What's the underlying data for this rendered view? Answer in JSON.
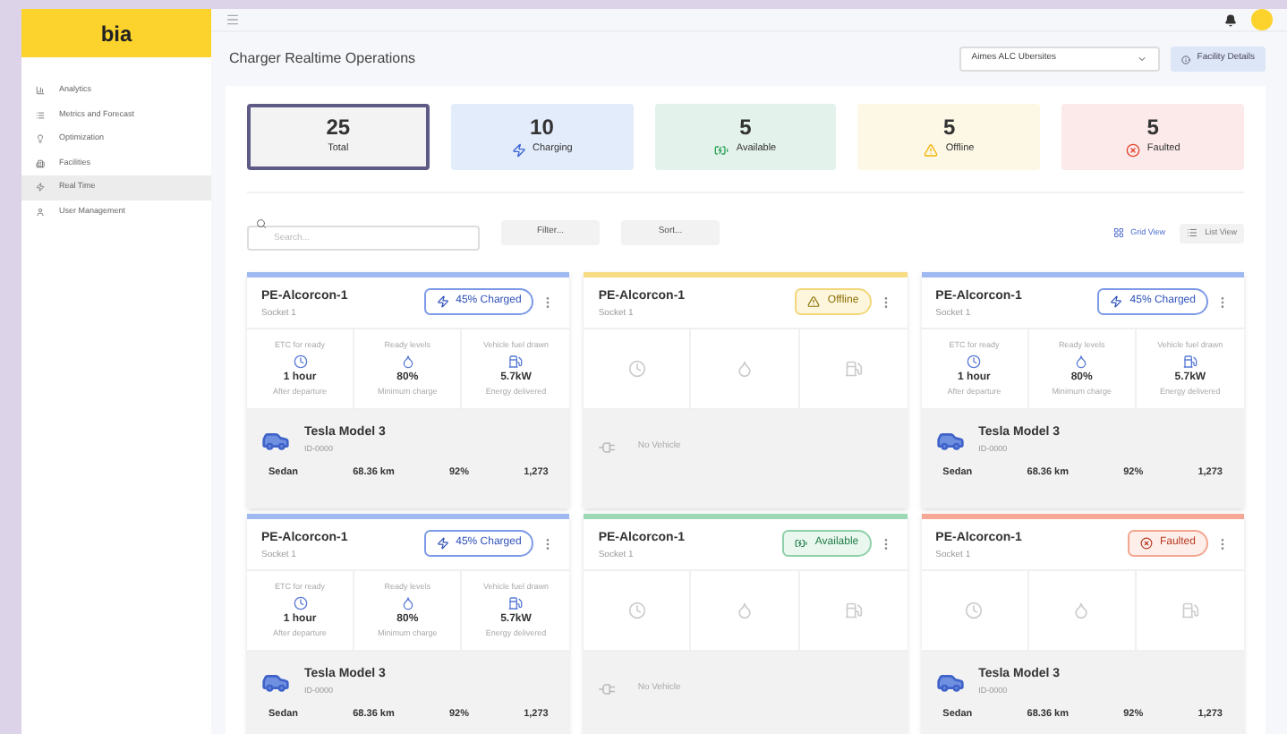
{
  "logo": "bia",
  "sidebar": {
    "items": [
      {
        "label": "Analytics",
        "selected": false
      },
      {
        "label": "Metrics and Forecast",
        "selected": false
      },
      {
        "label": "Optimization",
        "selected": false
      },
      {
        "label": "Facilities",
        "selected": false
      },
      {
        "label": "Real Time",
        "selected": true
      },
      {
        "label": "User Management",
        "selected": false
      }
    ]
  },
  "page_title": "Charger Realtime Operations",
  "facility_select": {
    "value": "Aimes ALC Ubersites"
  },
  "facility_button": "Facility Details",
  "stats": [
    {
      "kind": "total",
      "value": "25",
      "label": "Total",
      "selected": true
    },
    {
      "kind": "charging",
      "value": "10",
      "label": "Charging",
      "selected": false
    },
    {
      "kind": "available",
      "value": "5",
      "label": "Available",
      "selected": false
    },
    {
      "kind": "offline",
      "value": "5",
      "label": "Offline",
      "selected": false
    },
    {
      "kind": "faulted",
      "value": "5",
      "label": "Faulted",
      "selected": false
    }
  ],
  "search": {
    "placeholder": "Search..."
  },
  "filter_button": "Filter...",
  "sort_button": "Sort...",
  "views": [
    {
      "label": "Grid View",
      "selected": true
    },
    {
      "label": "List View",
      "selected": false
    }
  ],
  "chargers": [
    {
      "name": "PE-Alcorcon-1",
      "socket": "Socket 1",
      "kind": "charging",
      "badge": "45% Charged",
      "metrics": [
        {
          "label": "ETC for ready",
          "value": "1 hour",
          "note": "After departure"
        },
        {
          "label": "Ready levels",
          "value": "80%",
          "note": "Minimum charge"
        },
        {
          "label": "Vehicle fuel drawn",
          "value": "5.7kW",
          "note": "Energy delivered"
        }
      ],
      "vehicle": {
        "model": "Tesla Model 3",
        "id": "ID-0000",
        "specs": [
          "Sedan",
          "68.36 km",
          "92%",
          "1,273"
        ]
      }
    },
    {
      "name": "PE-Alcorcon-1",
      "socket": "Socket 1",
      "kind": "offline",
      "badge": "Offline",
      "no_vehicle": "No Vehicle"
    },
    {
      "name": "PE-Alcorcon-1",
      "socket": "Socket 1",
      "kind": "charging",
      "badge": "45% Charged",
      "metrics": [
        {
          "label": "ETC for ready",
          "value": "1 hour",
          "note": "After departure"
        },
        {
          "label": "Ready levels",
          "value": "80%",
          "note": "Minimum charge"
        },
        {
          "label": "Vehicle fuel drawn",
          "value": "5.7kW",
          "note": "Energy delivered"
        }
      ],
      "vehicle": {
        "model": "Tesla Model 3",
        "id": "ID-0000",
        "specs": [
          "Sedan",
          "68.36 km",
          "92%",
          "1,273"
        ]
      }
    },
    {
      "name": "PE-Alcorcon-1",
      "socket": "Socket 1",
      "kind": "charging",
      "badge": "45% Charged",
      "metrics": [
        {
          "label": "ETC for ready",
          "value": "1 hour",
          "note": "After departure"
        },
        {
          "label": "Ready levels",
          "value": "80%",
          "note": "Minimum charge"
        },
        {
          "label": "Vehicle fuel drawn",
          "value": "5.7kW",
          "note": "Energy delivered"
        }
      ],
      "vehicle": {
        "model": "Tesla Model 3",
        "id": "ID-0000",
        "specs": [
          "Sedan",
          "68.36 km",
          "92%",
          "1,273"
        ]
      }
    },
    {
      "name": "PE-Alcorcon-1",
      "socket": "Socket 1",
      "kind": "available",
      "badge": "Available",
      "no_vehicle": "No Vehicle"
    },
    {
      "name": "PE-Alcorcon-1",
      "socket": "Socket 1",
      "kind": "faulted",
      "badge": "Faulted",
      "vehicle": {
        "model": "Tesla Model 3",
        "id": "ID-0000",
        "specs": [
          "Sedan",
          "68.36 km",
          "92%",
          "1,273"
        ]
      }
    }
  ]
}
